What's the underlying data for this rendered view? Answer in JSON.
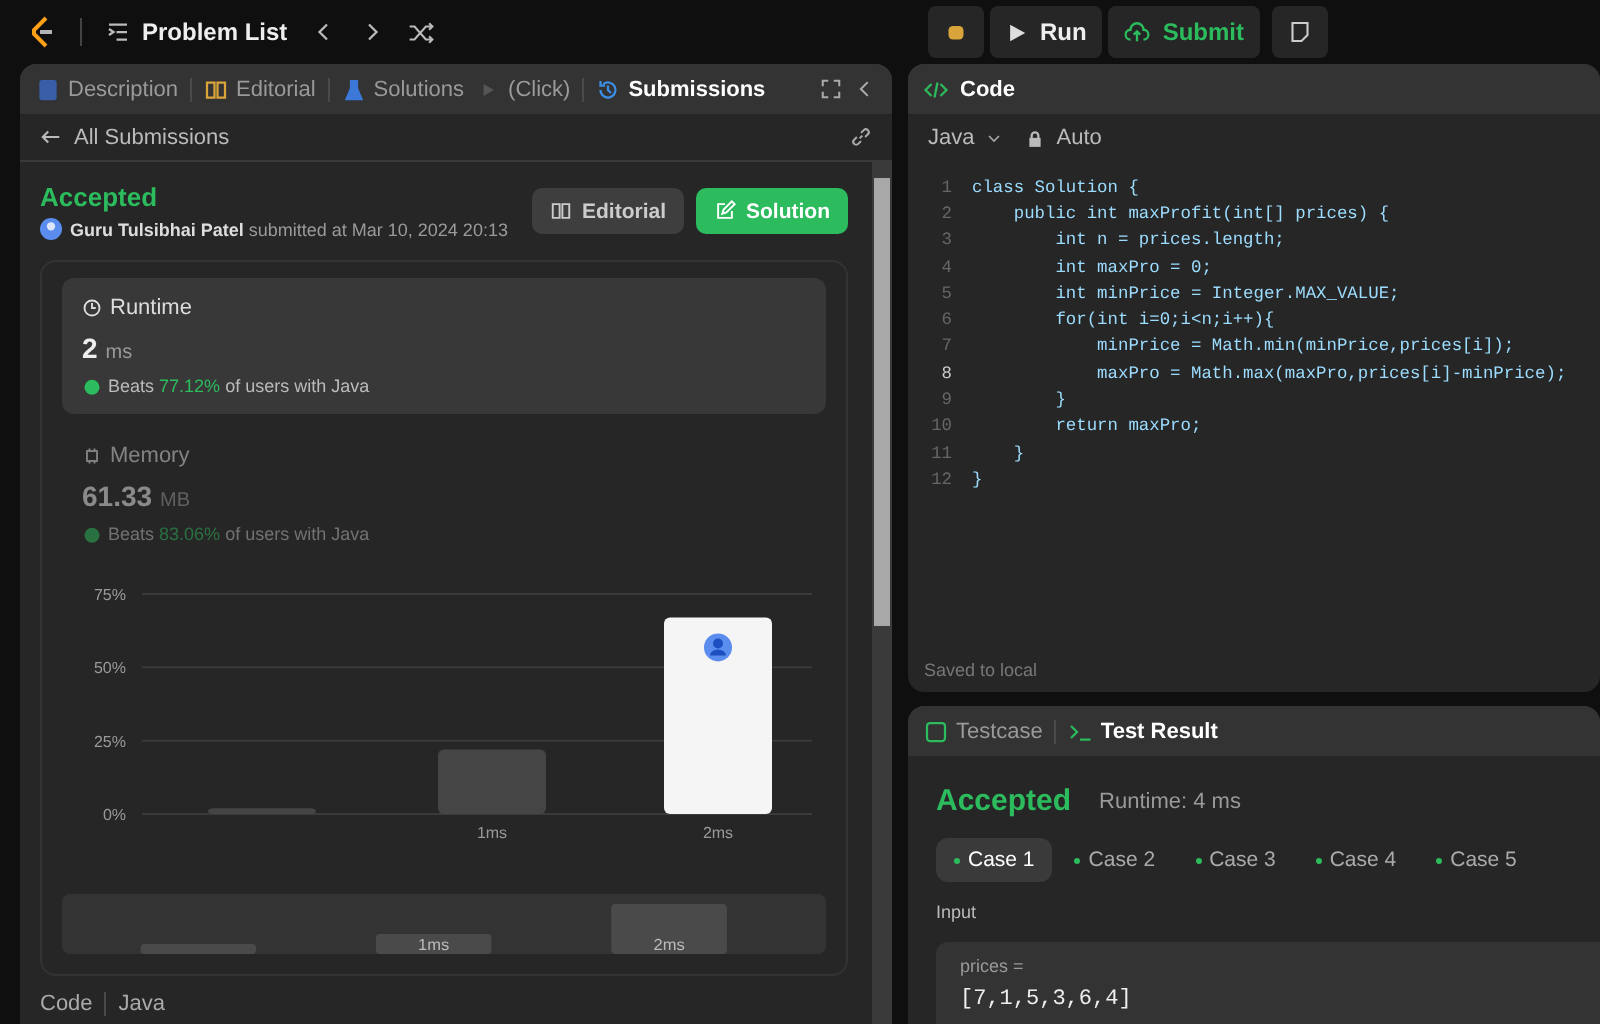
{
  "topbar": {
    "title": "Problem List",
    "run": "Run",
    "submit": "Submit"
  },
  "left_panel": {
    "tabs": [
      {
        "label": "Description",
        "selected": false
      },
      {
        "label": "Editorial",
        "selected": false
      },
      {
        "label": "Solutions",
        "selected": false
      },
      {
        "label": "(Click)",
        "selected": false
      },
      {
        "label": "Submissions",
        "selected": true
      }
    ],
    "back_link": "All Submissions",
    "status": "Accepted",
    "author": "Guru Tulsibhai Patel",
    "submitted": "submitted at Mar 10, 2024 20:13",
    "buttons": [
      {
        "label": "Editorial",
        "kind": "secondary"
      },
      {
        "label": "Solution",
        "kind": "primary"
      }
    ],
    "cards": [
      {
        "title": "Runtime",
        "value": "2",
        "unit": "ms",
        "beats": "Beats",
        "percent": "77.12%",
        "suffix": "of users with Java",
        "selected": true
      },
      {
        "title": "Memory",
        "value": "61.33",
        "unit": "MB",
        "beats": "Beats",
        "percent": "83.06%",
        "suffix": "of users with Java",
        "selected": false
      }
    ],
    "chart_data": {
      "type": "bar",
      "categories": [
        null,
        "1ms",
        "2ms"
      ],
      "values": [
        2,
        22,
        67
      ],
      "ylim": [
        0,
        75
      ],
      "yticks": [
        {
          "value": 0,
          "label": "0%"
        },
        {
          "value": 25,
          "label": "25%"
        },
        {
          "value": 50,
          "label": "50%"
        },
        {
          "value": 75,
          "label": "75%"
        }
      ]
    },
    "overview_labels": [
      "1ms",
      "2ms"
    ],
    "footer": [
      "Code",
      "Java"
    ]
  },
  "code_panel": {
    "title": "Code",
    "language": "Java",
    "mode": "Auto",
    "saved": "Saved to local",
    "lines": [
      {
        "n": "1",
        "current": false,
        "text": "class Solution {"
      },
      {
        "n": "2",
        "current": false,
        "text": "    public int maxProfit(int[] prices) {"
      },
      {
        "n": "3",
        "current": false,
        "text": "        int n = prices.length;"
      },
      {
        "n": "4",
        "current": false,
        "text": "        int maxPro = 0;"
      },
      {
        "n": "5",
        "current": false,
        "text": "        int minPrice = Integer.MAX_VALUE;"
      },
      {
        "n": "6",
        "current": false,
        "text": "        for(int i=0;i<n;i++){"
      },
      {
        "n": "7",
        "current": false,
        "text": "            minPrice = Math.min(minPrice,prices[i]);"
      },
      {
        "n": "8",
        "current": true,
        "text": "            maxPro = Math.max(maxPro,prices[i]-minPrice);"
      },
      {
        "n": "9",
        "current": false,
        "text": "        }"
      },
      {
        "n": "10",
        "current": false,
        "text": "        return maxPro;"
      },
      {
        "n": "11",
        "current": false,
        "text": "    }"
      },
      {
        "n": "12",
        "current": false,
        "text": "}"
      }
    ]
  },
  "result_panel": {
    "tabs": [
      {
        "label": "Testcase",
        "selected": false
      },
      {
        "label": "Test Result",
        "selected": true
      }
    ],
    "status": "Accepted",
    "runtime": "Runtime: 4 ms",
    "cases": [
      {
        "label": "Case 1",
        "selected": true
      },
      {
        "label": "Case 2",
        "selected": false
      },
      {
        "label": "Case 3",
        "selected": false
      },
      {
        "label": "Case 4",
        "selected": false
      },
      {
        "label": "Case 5",
        "selected": false
      }
    ],
    "input_label": "Input",
    "param": "prices =",
    "value": "[7,1,5,3,6,4]"
  }
}
